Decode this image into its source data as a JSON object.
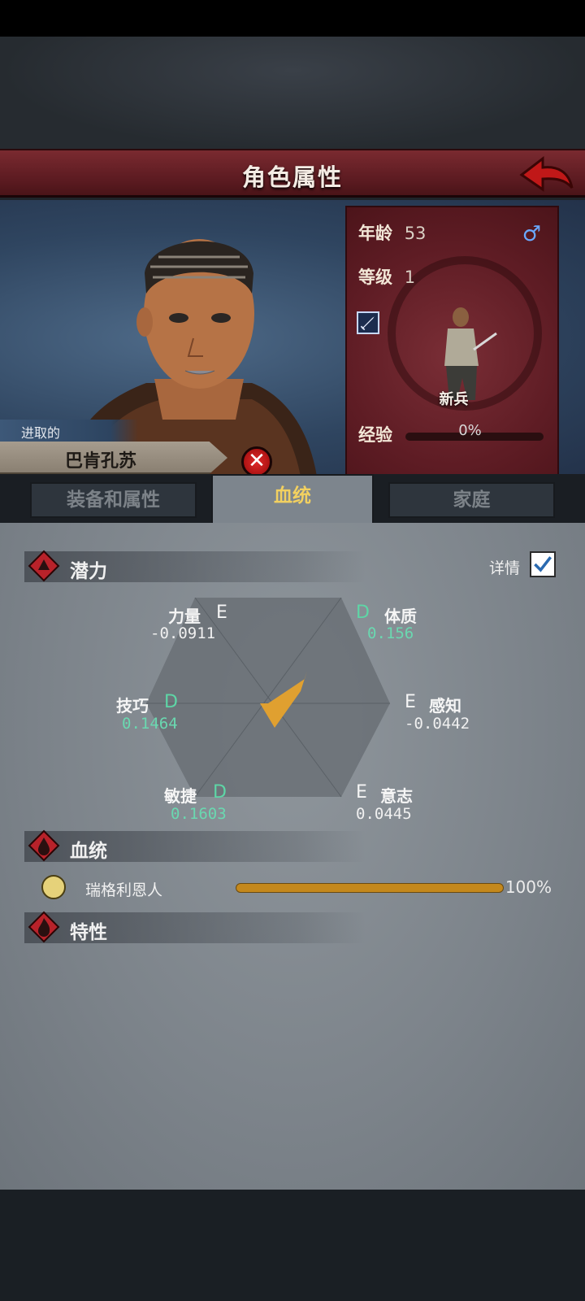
{
  "header": {
    "title": "角色属性"
  },
  "character": {
    "trait": "进取的",
    "name": "巴肯孔苏",
    "age_label": "年龄",
    "age_value": "53",
    "gender": "♂",
    "level_label": "等级",
    "level_value": "1",
    "class_label": "新兵",
    "exp_label": "经验",
    "exp_value": "0%"
  },
  "tabs": [
    {
      "label": "装备和属性"
    },
    {
      "label": "血统"
    },
    {
      "label": "家庭"
    }
  ],
  "potential": {
    "title": "潜力",
    "details_label": "详情",
    "details_checked": true,
    "stats": {
      "strength": {
        "name": "力量",
        "grade": "E",
        "value": "-0.0911"
      },
      "constitution": {
        "name": "体质",
        "grade": "D",
        "value": "0.156"
      },
      "skill": {
        "name": "技巧",
        "grade": "D",
        "value": "0.1464"
      },
      "perception": {
        "name": "感知",
        "grade": "E",
        "value": "-0.0442"
      },
      "agility": {
        "name": "敏捷",
        "grade": "D",
        "value": "0.1603"
      },
      "will": {
        "name": "意志",
        "grade": "E",
        "value": "0.0445"
      }
    }
  },
  "bloodline": {
    "title": "血统",
    "items": [
      {
        "name": "瑞格利恩人",
        "percent": "100%",
        "fraction": 1.0
      }
    ]
  },
  "traits_section": {
    "title": "特性"
  },
  "colors": {
    "accent": "#f2d060",
    "banner": "#6a2128",
    "grade_d": "#5ed6a6",
    "bar": "#c4881c"
  }
}
